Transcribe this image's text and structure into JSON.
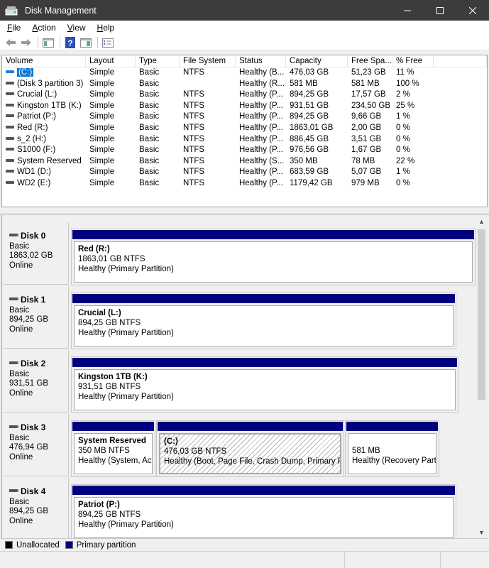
{
  "window": {
    "title": "Disk Management",
    "controls": [
      "minimize",
      "maximize",
      "close"
    ]
  },
  "menu": [
    {
      "label": "File",
      "accel": "F"
    },
    {
      "label": "Action",
      "accel": "A"
    },
    {
      "label": "View",
      "accel": "V"
    },
    {
      "label": "Help",
      "accel": "H"
    }
  ],
  "toolbar": [
    "back-icon",
    "forward-icon",
    "show-hide-console-tree-icon",
    "help-icon",
    "show-hide-action-pane-icon",
    "properties-icon"
  ],
  "volume_list": {
    "columns": [
      "Volume",
      "Layout",
      "Type",
      "File System",
      "Status",
      "Capacity",
      "Free Spa...",
      "% Free"
    ],
    "rows": [
      {
        "volume": "(C:)",
        "layout": "Simple",
        "type": "Basic",
        "fs": "NTFS",
        "status": "Healthy (B...",
        "capacity": "476,03 GB",
        "free": "51,23 GB",
        "pct": "11 %",
        "selected": true
      },
      {
        "volume": "(Disk 3 partition 3)",
        "layout": "Simple",
        "type": "Basic",
        "fs": "",
        "status": "Healthy (R...",
        "capacity": "581 MB",
        "free": "581 MB",
        "pct": "100 %"
      },
      {
        "volume": "Crucial (L:)",
        "layout": "Simple",
        "type": "Basic",
        "fs": "NTFS",
        "status": "Healthy (P...",
        "capacity": "894,25 GB",
        "free": "17,57 GB",
        "pct": "2 %"
      },
      {
        "volume": "Kingston 1TB (K:)",
        "layout": "Simple",
        "type": "Basic",
        "fs": "NTFS",
        "status": "Healthy (P...",
        "capacity": "931,51 GB",
        "free": "234,50 GB",
        "pct": "25 %"
      },
      {
        "volume": "Patriot (P:)",
        "layout": "Simple",
        "type": "Basic",
        "fs": "NTFS",
        "status": "Healthy (P...",
        "capacity": "894,25 GB",
        "free": "9,66 GB",
        "pct": "1 %"
      },
      {
        "volume": "Red (R:)",
        "layout": "Simple",
        "type": "Basic",
        "fs": "NTFS",
        "status": "Healthy (P...",
        "capacity": "1863,01 GB",
        "free": "2,00 GB",
        "pct": "0 %"
      },
      {
        "volume": "s_2 (H:)",
        "layout": "Simple",
        "type": "Basic",
        "fs": "NTFS",
        "status": "Healthy (P...",
        "capacity": "886,45 GB",
        "free": "3,51 GB",
        "pct": "0 %"
      },
      {
        "volume": "S1000 (F:)",
        "layout": "Simple",
        "type": "Basic",
        "fs": "NTFS",
        "status": "Healthy (P...",
        "capacity": "976,56 GB",
        "free": "1,67 GB",
        "pct": "0 %"
      },
      {
        "volume": "System Reserved",
        "layout": "Simple",
        "type": "Basic",
        "fs": "NTFS",
        "status": "Healthy (S...",
        "capacity": "350 MB",
        "free": "78 MB",
        "pct": "22 %"
      },
      {
        "volume": "WD1 (D:)",
        "layout": "Simple",
        "type": "Basic",
        "fs": "NTFS",
        "status": "Healthy (P...",
        "capacity": "683,59 GB",
        "free": "5,07 GB",
        "pct": "1 %"
      },
      {
        "volume": "WD2 (E:)",
        "layout": "Simple",
        "type": "Basic",
        "fs": "NTFS",
        "status": "Healthy (P...",
        "capacity": "1179,42 GB",
        "free": "979 MB",
        "pct": "0 %"
      }
    ]
  },
  "disks": [
    {
      "name": "Disk 0",
      "type": "Basic",
      "size": "1863,02 GB",
      "state": "Online",
      "partitions": [
        {
          "name": "Red  (R:)",
          "size": "1863,01 GB NTFS",
          "status": "Healthy (Primary Partition)"
        }
      ]
    },
    {
      "name": "Disk 1",
      "type": "Basic",
      "size": "894,25 GB",
      "state": "Online",
      "partitions": [
        {
          "name": "Crucial  (L:)",
          "size": "894,25 GB NTFS",
          "status": "Healthy (Primary Partition)"
        }
      ]
    },
    {
      "name": "Disk 2",
      "type": "Basic",
      "size": "931,51 GB",
      "state": "Online",
      "partitions": [
        {
          "name": "Kingston 1TB  (K:)",
          "size": "931,51 GB NTFS",
          "status": "Healthy (Primary Partition)"
        }
      ]
    },
    {
      "name": "Disk 3",
      "type": "Basic",
      "size": "476,94 GB",
      "state": "Online",
      "partitions": [
        {
          "name": "System Reserved",
          "size": "350 MB NTFS",
          "status": "Healthy (System, Acti"
        },
        {
          "name": "(C:)",
          "size": "476,03 GB NTFS",
          "status": "Healthy (Boot, Page File, Crash Dump, Primary Partit",
          "selected": true
        },
        {
          "name": "",
          "size": "581 MB",
          "status": "Healthy (Recovery Partit"
        }
      ]
    },
    {
      "name": "Disk 4",
      "type": "Basic",
      "size": "894,25 GB",
      "state": "Online",
      "partitions": [
        {
          "name": "Patriot  (P:)",
          "size": "894,25 GB NTFS",
          "status": "Healthy (Primary Partition)"
        }
      ]
    }
  ],
  "legend": [
    {
      "label": "Unallocated",
      "color": "#000000"
    },
    {
      "label": "Primary partition",
      "color": "#000080"
    }
  ],
  "colors": {
    "partition_bar": "#000080",
    "selection": "#0078d7",
    "titlebar": "#3c3c3c"
  }
}
